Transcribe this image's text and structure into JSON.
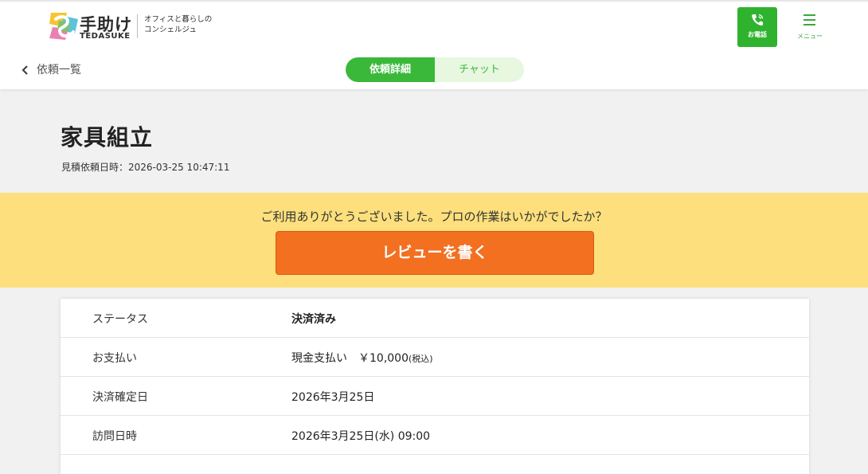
{
  "header": {
    "logo_name": "手助け",
    "logo_en": "TEDASUKE",
    "tagline_line1": "オフィスと暮らしの",
    "tagline_line2": "コンシェルジュ",
    "phone_label": "お電話",
    "menu_label": "メニュー"
  },
  "subnav": {
    "back_label": "依頼一覧",
    "tabs": [
      {
        "label": "依頼詳細",
        "active": true
      },
      {
        "label": "チャット",
        "active": false
      }
    ]
  },
  "request": {
    "title": "家具組立",
    "date_line": "見積依頼日時：2026-03-25 10:47:11"
  },
  "banner": {
    "message": "ご利用ありがとうございました。プロの作業はいかがでしたか？",
    "button_label": "レビューを書く"
  },
  "details": {
    "rows": [
      {
        "label": "ステータス",
        "value": "決済済み"
      },
      {
        "label": "お支払い",
        "value": "現金支払い　￥10,000",
        "suffix": "(税込)"
      },
      {
        "label": "決済確定日",
        "value": "2026年3月25日"
      },
      {
        "label": "訪問日時",
        "value": "2026年3月25日(水) 09:00"
      }
    ]
  },
  "colors": {
    "brand_green": "#3ab83a",
    "banner_yellow": "#fde07d",
    "cta_orange": "#f37021"
  },
  "icons": [
    "logo-mark-icon",
    "phone-icon",
    "menu-icon",
    "chevron-left-icon"
  ]
}
